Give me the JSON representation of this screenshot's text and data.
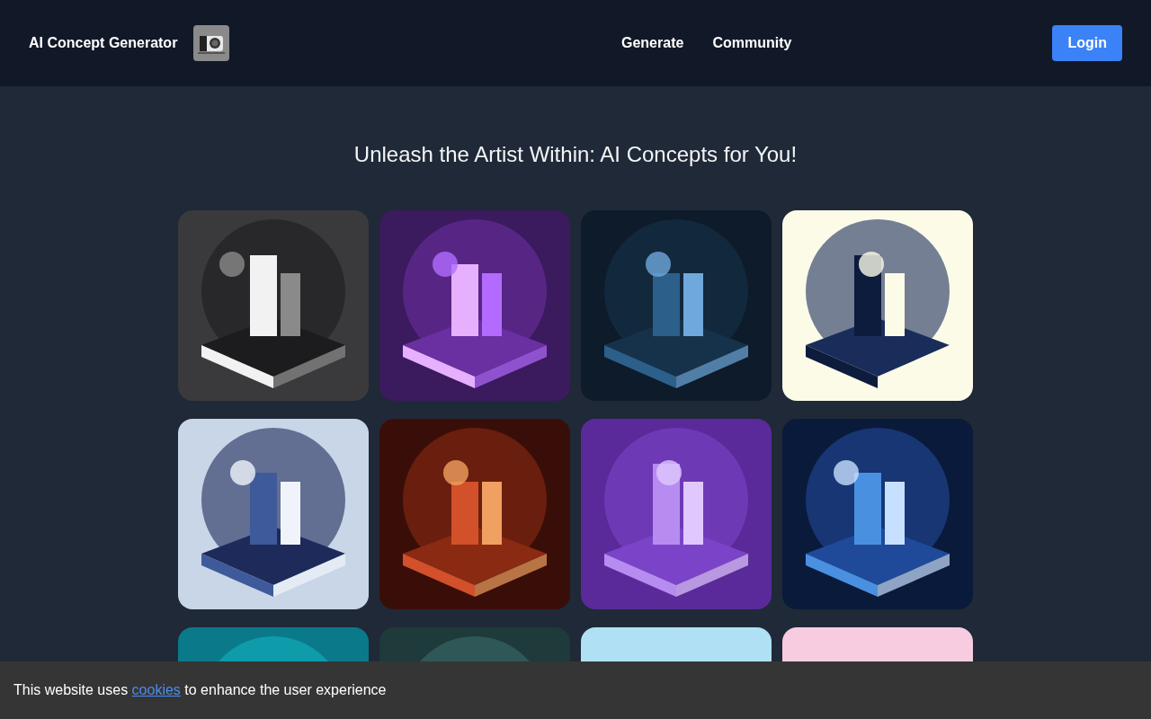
{
  "header": {
    "brand": "AI Concept Generator",
    "nav": [
      {
        "label": "Generate"
      },
      {
        "label": "Community"
      }
    ],
    "login": "Login"
  },
  "hero": {
    "title": "Unleash the Artist Within: AI Concepts for You!"
  },
  "cookie_banner": {
    "before": "This website uses ",
    "link": "cookies",
    "after": " to enhance the user experience"
  }
}
